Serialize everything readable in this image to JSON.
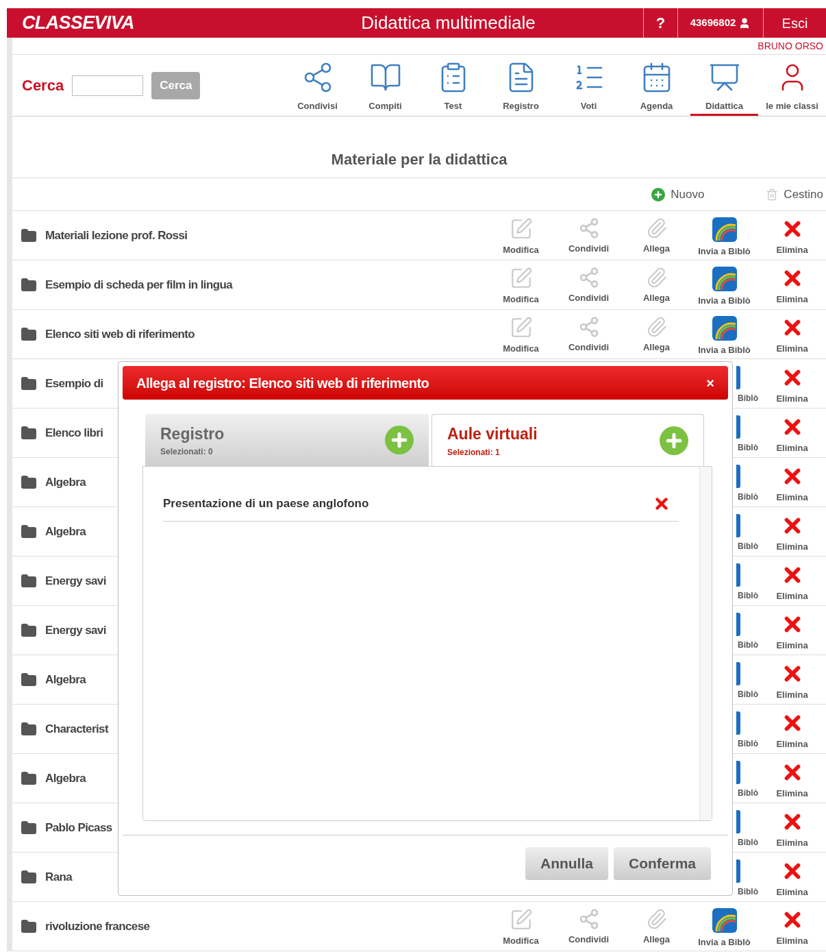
{
  "header": {
    "logo": "CLASSEVIVA",
    "title": "Didattica multimediale",
    "help": "?",
    "user_code": "43696802",
    "logout": "Esci",
    "user_name": "BRUNO ORSO"
  },
  "search": {
    "label": "Cerca",
    "button": "Cerca",
    "button_disabled": true
  },
  "nav": [
    {
      "kind": "share",
      "label": "Condivisi",
      "selected": false
    },
    {
      "kind": "book",
      "label": "Compiti",
      "selected": false
    },
    {
      "kind": "test",
      "label": "Test",
      "selected": false
    },
    {
      "kind": "register",
      "label": "Registro",
      "selected": false
    },
    {
      "kind": "grades",
      "label": "Voti",
      "selected": false
    },
    {
      "kind": "calendar",
      "label": "Agenda",
      "selected": false
    },
    {
      "kind": "board",
      "label": "Didattica",
      "selected": true
    },
    {
      "kind": "person",
      "label": "le mie classi",
      "selected": false
    }
  ],
  "heading": "Materiale per la didattica",
  "toolbar": {
    "new": "Nuovo",
    "trash": "Cestino"
  },
  "rows": [
    {
      "name": "Materiali lezione prof. Rossi",
      "actions": [
        {
          "kind": "edit",
          "label": "Modifica"
        },
        {
          "kind": "share",
          "label": "Condividi"
        },
        {
          "kind": "attach",
          "label": "Allega"
        },
        {
          "kind": "biblo",
          "label": "Invia a Biblò"
        },
        {
          "kind": "delete",
          "label": "Elimina"
        }
      ]
    },
    {
      "name": "Esempio di scheda per film in lingua",
      "actions": [
        {
          "kind": "edit",
          "label": "Modifica"
        },
        {
          "kind": "share",
          "label": "Condividi"
        },
        {
          "kind": "attach",
          "label": "Allega"
        },
        {
          "kind": "biblo",
          "label": "Invia a Biblò"
        },
        {
          "kind": "delete",
          "label": "Elimina"
        }
      ]
    },
    {
      "name": "Elenco siti web di riferimento",
      "actions": [
        {
          "kind": "edit",
          "label": "Modifica"
        },
        {
          "kind": "share",
          "label": "Condividi"
        },
        {
          "kind": "attach",
          "label": "Allega"
        },
        {
          "kind": "biblo",
          "label": "Invia a Biblò"
        },
        {
          "kind": "delete",
          "label": "Elimina"
        }
      ]
    },
    {
      "name": "Esempio di",
      "actions": [
        {
          "kind": "biblo_partial",
          "label": "Biblò"
        },
        {
          "kind": "delete",
          "label": "Elimina"
        }
      ]
    },
    {
      "name": "Elenco libri",
      "actions": [
        {
          "kind": "biblo_partial",
          "label": "Biblò"
        },
        {
          "kind": "delete",
          "label": "Elimina"
        }
      ]
    },
    {
      "name": "Algebra",
      "actions": [
        {
          "kind": "biblo_partial",
          "label": "Biblò"
        },
        {
          "kind": "delete",
          "label": "Elimina"
        }
      ]
    },
    {
      "name": "Algebra",
      "actions": [
        {
          "kind": "biblo_partial",
          "label": "Biblò"
        },
        {
          "kind": "delete",
          "label": "Elimina"
        }
      ]
    },
    {
      "name": "Energy savi",
      "actions": [
        {
          "kind": "biblo_partial",
          "label": "Biblò"
        },
        {
          "kind": "delete",
          "label": "Elimina"
        }
      ]
    },
    {
      "name": "Energy savi",
      "actions": [
        {
          "kind": "biblo_partial",
          "label": "Biblò"
        },
        {
          "kind": "delete",
          "label": "Elimina"
        }
      ]
    },
    {
      "name": "Algebra",
      "actions": [
        {
          "kind": "biblo_partial",
          "label": "Biblò"
        },
        {
          "kind": "delete",
          "label": "Elimina"
        }
      ]
    },
    {
      "name": "Characterist",
      "actions": [
        {
          "kind": "biblo_partial",
          "label": "Biblò"
        },
        {
          "kind": "delete",
          "label": "Elimina"
        }
      ]
    },
    {
      "name": "Algebra",
      "actions": [
        {
          "kind": "biblo_partial",
          "label": "Biblò"
        },
        {
          "kind": "delete",
          "label": "Elimina"
        }
      ]
    },
    {
      "name": "Pablo Picass",
      "actions": [
        {
          "kind": "biblo_partial",
          "label": "Biblò"
        },
        {
          "kind": "delete",
          "label": "Elimina"
        }
      ]
    },
    {
      "name": "Rana",
      "actions": [
        {
          "kind": "biblo_partial",
          "label": "Biblò"
        },
        {
          "kind": "delete",
          "label": "Elimina"
        }
      ]
    },
    {
      "name": "rivoluzione francese",
      "actions": [
        {
          "kind": "edit",
          "label": "Modifica"
        },
        {
          "kind": "share",
          "label": "Condividi"
        },
        {
          "kind": "attach",
          "label": "Allega"
        },
        {
          "kind": "biblo",
          "label": "Invia a Biblò"
        },
        {
          "kind": "delete",
          "label": "Elimina"
        }
      ]
    }
  ],
  "dialog": {
    "title": "Allega al registro: Elenco siti web di riferimento",
    "close": "×",
    "tabs": [
      {
        "label": "Registro",
        "count": "Selezionati: 0",
        "selected": false
      },
      {
        "label": "Aule virtuali",
        "count": "Selezionati: 1",
        "selected": true
      }
    ],
    "items": [
      "Presentazione di un paese anglofono"
    ],
    "buttons": [
      "Annulla",
      "Conferma"
    ]
  }
}
